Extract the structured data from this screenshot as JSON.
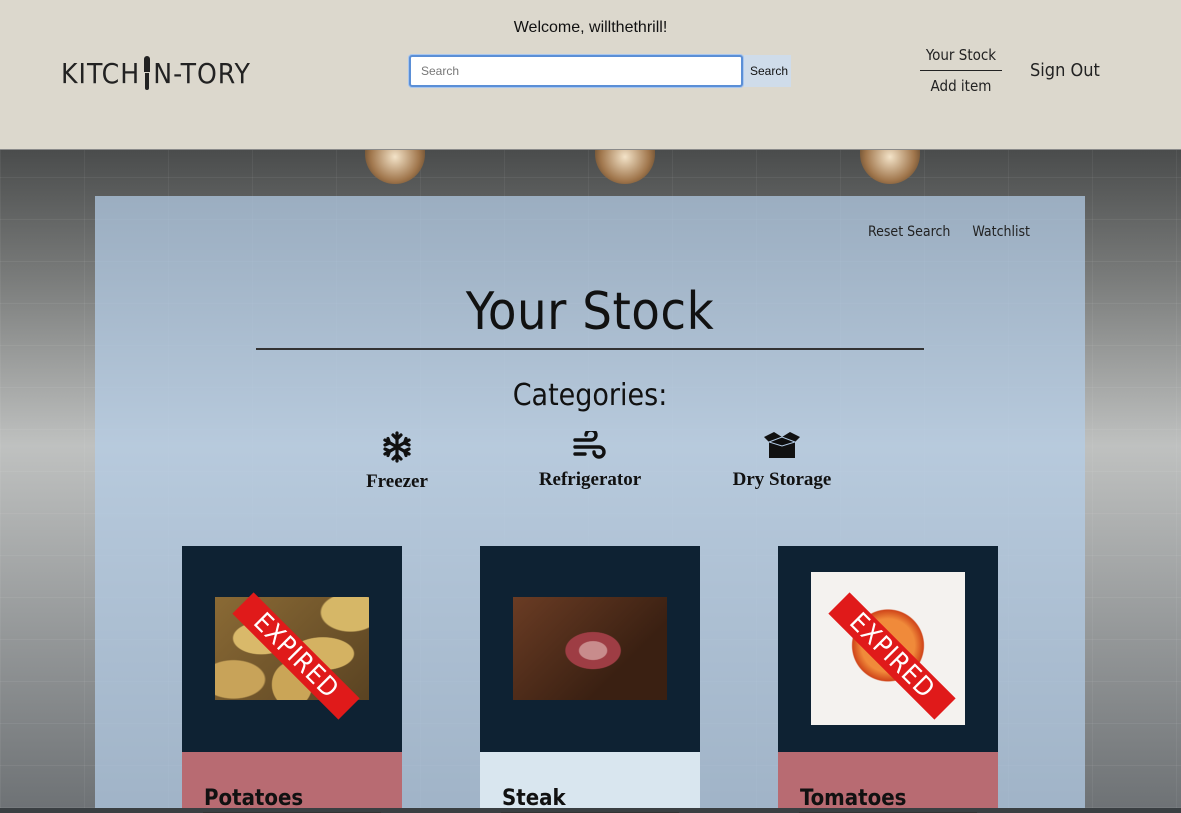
{
  "header": {
    "logo": "KITCH",
    "logo_rest": "N-TORY",
    "welcome": "Welcome, willthethrill!",
    "search_placeholder": "Search",
    "search_button": "Search",
    "nav": {
      "your_stock": "Your Stock",
      "add_item": "Add item"
    },
    "sign_out": "Sign Out"
  },
  "panel": {
    "reset_search": "Reset Search",
    "watchlist": "Watchlist",
    "title": "Your Stock",
    "categories_label": "Categories:",
    "categories": [
      {
        "label": "Freezer",
        "icon": "snowflake-icon"
      },
      {
        "label": "Refrigerator",
        "icon": "wind-icon"
      },
      {
        "label": "Dry Storage",
        "icon": "box-open-icon"
      }
    ]
  },
  "items": [
    {
      "name": "Potatoes",
      "status": "EXPIRED",
      "status_color": "#e01a1a",
      "footer_color": "#b86b72"
    },
    {
      "name": "Steak",
      "status": "",
      "footer_color": "#d9e6ef"
    },
    {
      "name": "Tomatoes",
      "status": "EXPIRED",
      "status_color": "#e01a1a",
      "footer_color": "#b86b72"
    }
  ]
}
